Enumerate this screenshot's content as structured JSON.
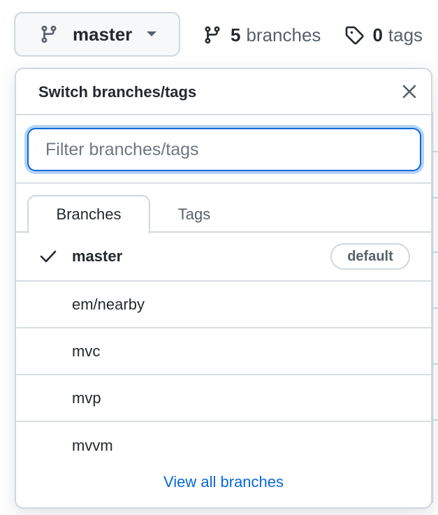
{
  "top": {
    "branch_button_label": "master",
    "branches_count": "5",
    "branches_word": "branches",
    "tags_count": "0",
    "tags_word": "tags"
  },
  "dropdown": {
    "title": "Switch branches/tags",
    "filter_placeholder": "Filter branches/tags",
    "filter_value": "",
    "tabs": [
      {
        "label": "Branches",
        "active": true
      },
      {
        "label": "Tags",
        "active": false
      }
    ],
    "branches": [
      {
        "name": "master",
        "selected": true,
        "badge": "default"
      },
      {
        "name": "em/nearby",
        "selected": false
      },
      {
        "name": "mvc",
        "selected": false
      },
      {
        "name": "mvp",
        "selected": false
      },
      {
        "name": "mvvm",
        "selected": false
      }
    ],
    "view_all_label": "View all branches"
  },
  "icons": {
    "branch": "git-branch-icon",
    "tag": "tag-icon",
    "caret": "caret-down-icon",
    "close": "close-icon",
    "check": "check-icon"
  },
  "colors": {
    "accent": "#0969da",
    "text": "#24292f",
    "muted": "#57606a",
    "border": "#d0d7de",
    "button_bg": "#f6f8fa"
  }
}
